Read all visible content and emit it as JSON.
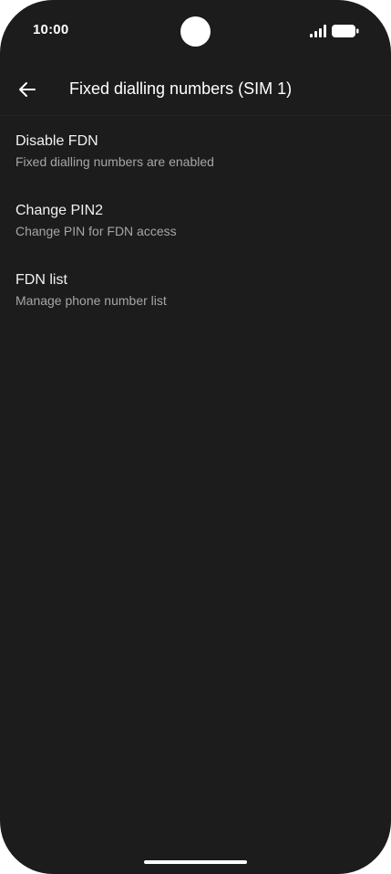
{
  "status_bar": {
    "time": "10:00",
    "icons": [
      "signal-icon",
      "battery-icon"
    ]
  },
  "app_bar": {
    "back_icon": "arrow-left-icon",
    "title": "Fixed dialling numbers (SIM 1)"
  },
  "settings": {
    "items": [
      {
        "title": "Disable FDN",
        "subtitle": "Fixed dialling numbers are enabled"
      },
      {
        "title": "Change PIN2",
        "subtitle": "Change PIN for FDN access"
      },
      {
        "title": "FDN list",
        "subtitle": "Manage phone number list"
      }
    ]
  },
  "colors": {
    "background": "#1c1c1c",
    "primary_text": "#f2f2f2",
    "secondary_text": "#a6a6a6"
  }
}
